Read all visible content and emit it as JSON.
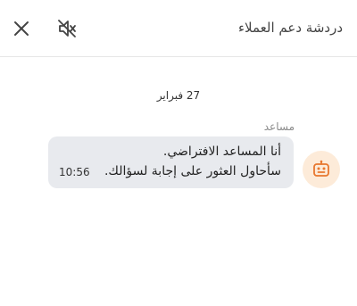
{
  "header": {
    "title": "دردشة دعم العملاء",
    "close_icon": "close-icon",
    "mute_icon": "speaker-muted-icon"
  },
  "conversation": {
    "date_separator": "27 فبراير",
    "messages": [
      {
        "sender": "مساعد",
        "avatar_icon": "bot-icon",
        "lines": [
          "أنا المساعد الافتراضي.",
          "سأحاول العثور على إجابة لسؤالك."
        ],
        "time": "10:56"
      }
    ]
  },
  "colors": {
    "bubble_bg": "#e8eaee",
    "avatar_bg": "#fdebd9",
    "avatar_icon": "#e8772e"
  }
}
